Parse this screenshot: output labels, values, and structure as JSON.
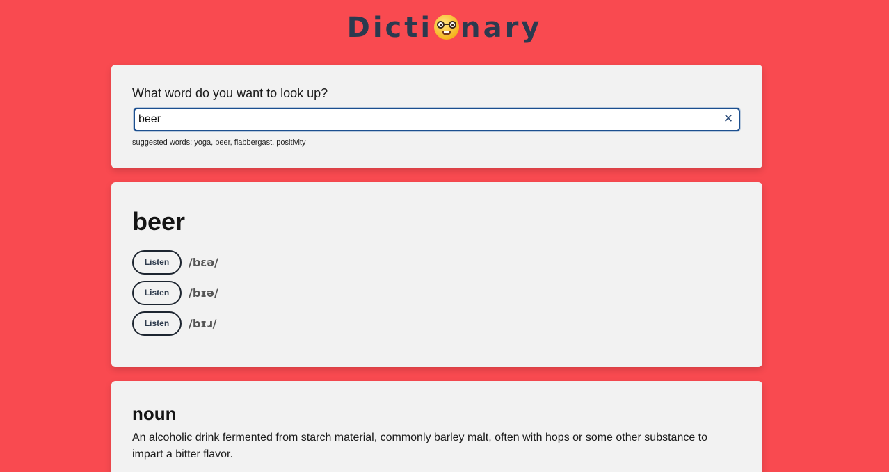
{
  "header": {
    "logo_left": "Dicti",
    "logo_right": "nary",
    "logo_emoji_icon": "nerd-face-icon"
  },
  "search": {
    "question": "What word do you want to look up?",
    "value": "beer",
    "clear_icon": "close-icon",
    "suggested_label": "suggested words: yoga, beer, flabbergast, positivity"
  },
  "result": {
    "word": "beer",
    "phonetics": [
      {
        "button_label": "Listen",
        "text": "/bɛə/"
      },
      {
        "button_label": "Listen",
        "text": "/bɪə/"
      },
      {
        "button_label": "Listen",
        "text": "/bɪɹ/"
      }
    ]
  },
  "meaning": {
    "part_of_speech": "noun",
    "definition": "An alcoholic drink fermented from starch material, commonly barley malt, often with hops or some other substance to impart a bitter flavor."
  },
  "colors": {
    "background": "#f94a50",
    "card": "#f2f2f2",
    "logo": "#2b3a4f",
    "input_border": "#1c4f8f"
  }
}
